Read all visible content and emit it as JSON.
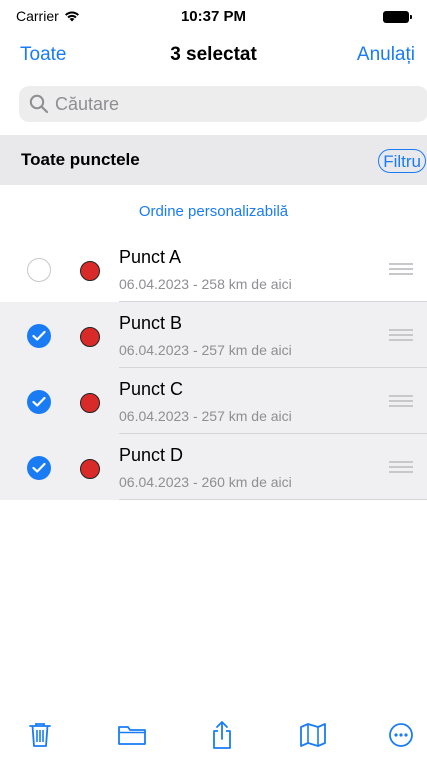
{
  "status_bar": {
    "carrier": "Carrier",
    "time": "10:37 PM"
  },
  "nav": {
    "left_label": "Toate",
    "title": "3 selectat",
    "right_label": "Anulați"
  },
  "search": {
    "placeholder": "Căutare"
  },
  "section": {
    "title": "Toate punctele",
    "filter_label": "Filtru"
  },
  "order_label": "Ordine personalizabilă",
  "points": [
    {
      "name": "Punct A",
      "subtitle": "06.04.2023 - 258 km de aici",
      "selected": false
    },
    {
      "name": "Punct B",
      "subtitle": "06.04.2023 - 257 km de aici",
      "selected": true
    },
    {
      "name": "Punct C",
      "subtitle": "06.04.2023 - 257 km de aici",
      "selected": true
    },
    {
      "name": "Punct D",
      "subtitle": "06.04.2023 - 260 km de aici",
      "selected": true
    }
  ],
  "toolbar": {
    "icons": [
      "trash-icon",
      "folder-icon",
      "share-icon",
      "map-icon",
      "more-icon"
    ]
  },
  "colors": {
    "accent": "#1a7cf5",
    "marker": "#d92a2a",
    "selected_row": "#f0f0f2"
  }
}
